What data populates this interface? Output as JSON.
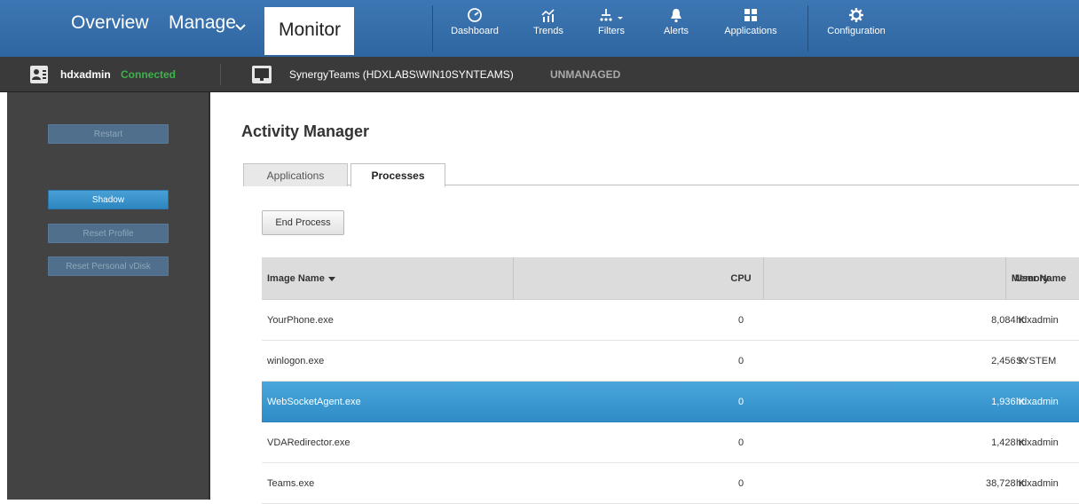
{
  "nav": {
    "tabs": [
      "Overview",
      "Manage",
      "Monitor"
    ],
    "tools": {
      "dashboard": {
        "label": "Dashboard",
        "icon": "dashboard-gauge-icon"
      },
      "trends": {
        "label": "Trends",
        "icon": "trends-chart-icon"
      },
      "filters": {
        "label": "Filters",
        "icon": "filters-icon"
      },
      "alerts": {
        "label": "Alerts",
        "icon": "bell-icon"
      },
      "applications": {
        "label": "Applications",
        "icon": "grid-icon"
      },
      "configuration": {
        "label": "Configuration",
        "icon": "gear-icon"
      }
    },
    "accent_color": "#3a74b1"
  },
  "status": {
    "user": "hdxadmin",
    "connection": "Connected",
    "machine": "SynergyTeams (HDXLABS\\WIN10SYNTEAMS)",
    "machine_state": "UNMANAGED"
  },
  "sidebar": {
    "restart": "Restart",
    "shadow": "Shadow",
    "reset_profile": "Reset Profile",
    "reset_vdisk": "Reset Personal vDisk"
  },
  "main": {
    "title": "Activity Manager",
    "tabs": {
      "applications": "Applications",
      "processes": "Processes"
    },
    "end_process": "End Process",
    "columns": {
      "image_name": "Image Name",
      "cpu": "CPU",
      "memory": "Memory",
      "user_name": "User Name"
    },
    "rows": [
      {
        "name": "YourPhone.exe",
        "cpu": "0",
        "memory": "8,084 K",
        "user": "hdxadmin",
        "selected": false
      },
      {
        "name": "winlogon.exe",
        "cpu": "0",
        "memory": "2,456 K",
        "user": "SYSTEM",
        "selected": false
      },
      {
        "name": "WebSocketAgent.exe",
        "cpu": "0",
        "memory": "1,936 K",
        "user": "hdxadmin",
        "selected": true
      },
      {
        "name": "VDARedirector.exe",
        "cpu": "0",
        "memory": "1,428 K",
        "user": "hdxadmin",
        "selected": false
      },
      {
        "name": "Teams.exe",
        "cpu": "0",
        "memory": "38,728 K",
        "user": "hdxadmin",
        "selected": false
      }
    ]
  }
}
